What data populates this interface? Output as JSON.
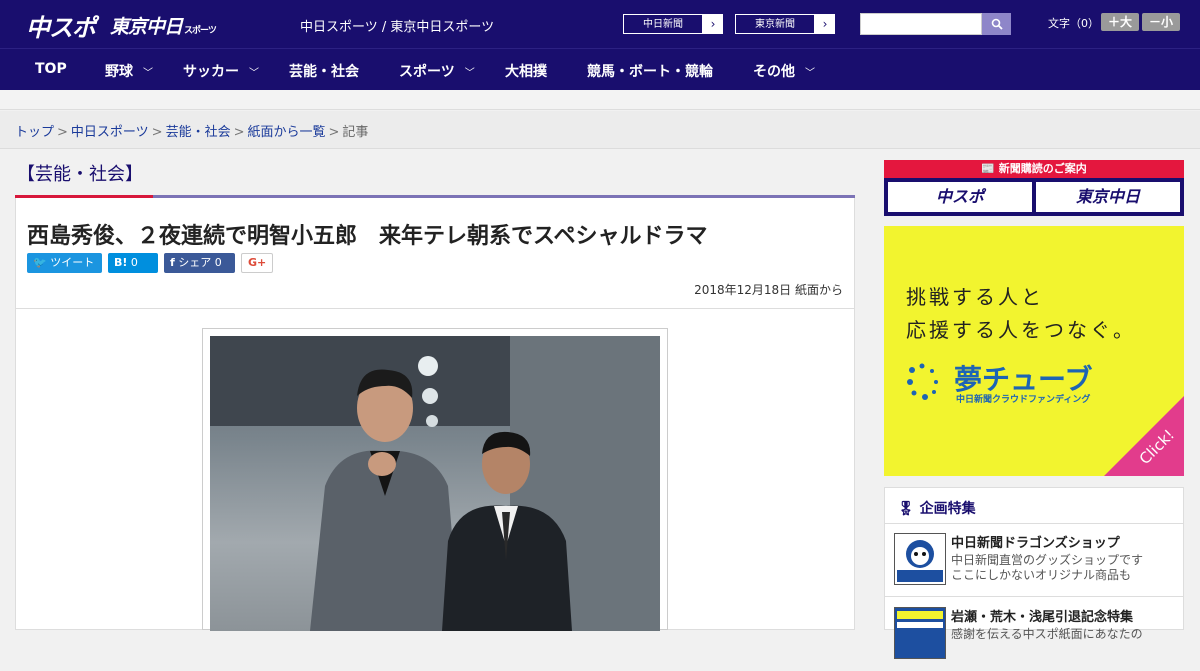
{
  "header": {
    "logo_chuspo": "中スポ",
    "logo_tokyo": "東京中日",
    "logo_tokyo_suffix": "スポーツ",
    "site_subtitle": "中日スポーツ / 東京中日スポーツ",
    "paper_links": [
      "中日新聞",
      "東京新聞"
    ],
    "text_size_label": "文字（0）",
    "size_up": "＋大",
    "size_down": "－小"
  },
  "nav": {
    "items": [
      {
        "label": "TOP"
      },
      {
        "label": "野球"
      },
      {
        "label": "サッカー"
      },
      {
        "label": "芸能・社会"
      },
      {
        "label": "スポーツ"
      },
      {
        "label": "大相撲"
      },
      {
        "label": "競馬・ボート・競輪"
      },
      {
        "label": "その他"
      }
    ]
  },
  "breadcrumb": [
    "トップ",
    "中日スポーツ",
    "芸能・社会",
    "紙面から一覧",
    "記事"
  ],
  "article": {
    "category": "【芸能・社会】",
    "headline": "西島秀俊、２夜連続で明智小五郎　来年テレ朝系でスペシャルドラマ",
    "share": {
      "tweet": "ツイート",
      "hatena": "0",
      "facebook": "シェア",
      "facebook_count": "0",
      "google": "G+"
    },
    "date": "2018年12月18日 紙面から"
  },
  "sidebar": {
    "subscribe_head": "新聞購読のご案内",
    "subscribe_logos": [
      "中スポ",
      "東京中日"
    ],
    "banner_lines": [
      "挑戦する人と",
      "応援する人をつなぐ。"
    ],
    "banner_brand": "夢チューブ",
    "banner_sub": "中日新聞クラウドファンディング",
    "banner_click": "Click!",
    "feature_head": "企画特集",
    "features": [
      {
        "title": "中日新聞ドラゴンズショップ",
        "desc1": "中日新聞直営のグッズショップです",
        "desc2": "ここにしかないオリジナル商品も"
      },
      {
        "title": "岩瀬・荒木・浅尾引退記念特集",
        "desc1": "感謝を伝える中スポ紙面にあなたの",
        "desc2": ""
      }
    ]
  },
  "colors": {
    "brand": "#190e6e",
    "accent": "#d7173b",
    "banner": "#f2f42f"
  }
}
